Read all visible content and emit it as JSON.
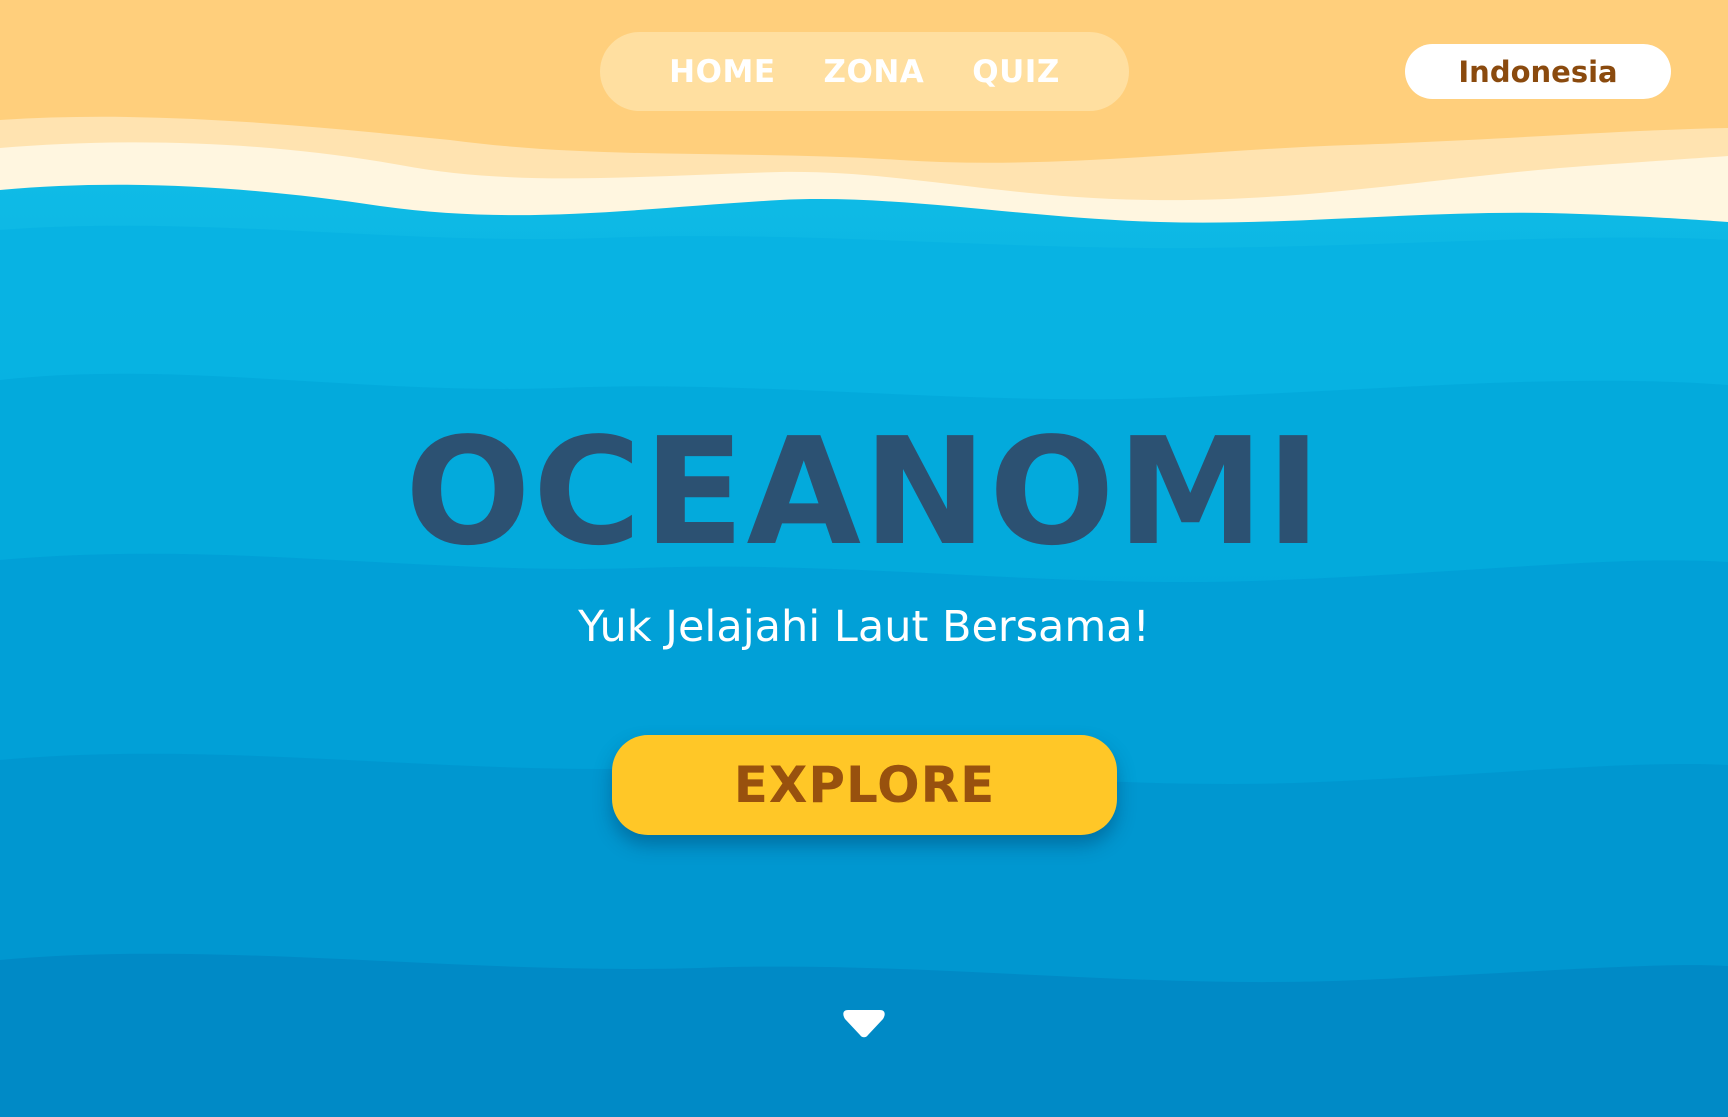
{
  "nav": {
    "items": [
      {
        "label": "HOME"
      },
      {
        "label": "ZONA"
      },
      {
        "label": "QUIZ"
      }
    ]
  },
  "language": {
    "label": "Indonesia"
  },
  "hero": {
    "title": "OCEANOMI",
    "subtitle": "Yuk Jelajahi Laut Bersama!",
    "cta_label": "EXPLORE"
  },
  "scroll_indicator": {
    "icon": "chevron-down-icon"
  },
  "colors": {
    "sand": "#ffd07e",
    "foam": "#fff4dc",
    "ocean_light": "#12bde8",
    "ocean_deep": "#0084c6",
    "title": "#2c5172",
    "cta_bg": "#ffc727",
    "cta_text": "#98510e",
    "lang_text": "#8a4a0e"
  }
}
